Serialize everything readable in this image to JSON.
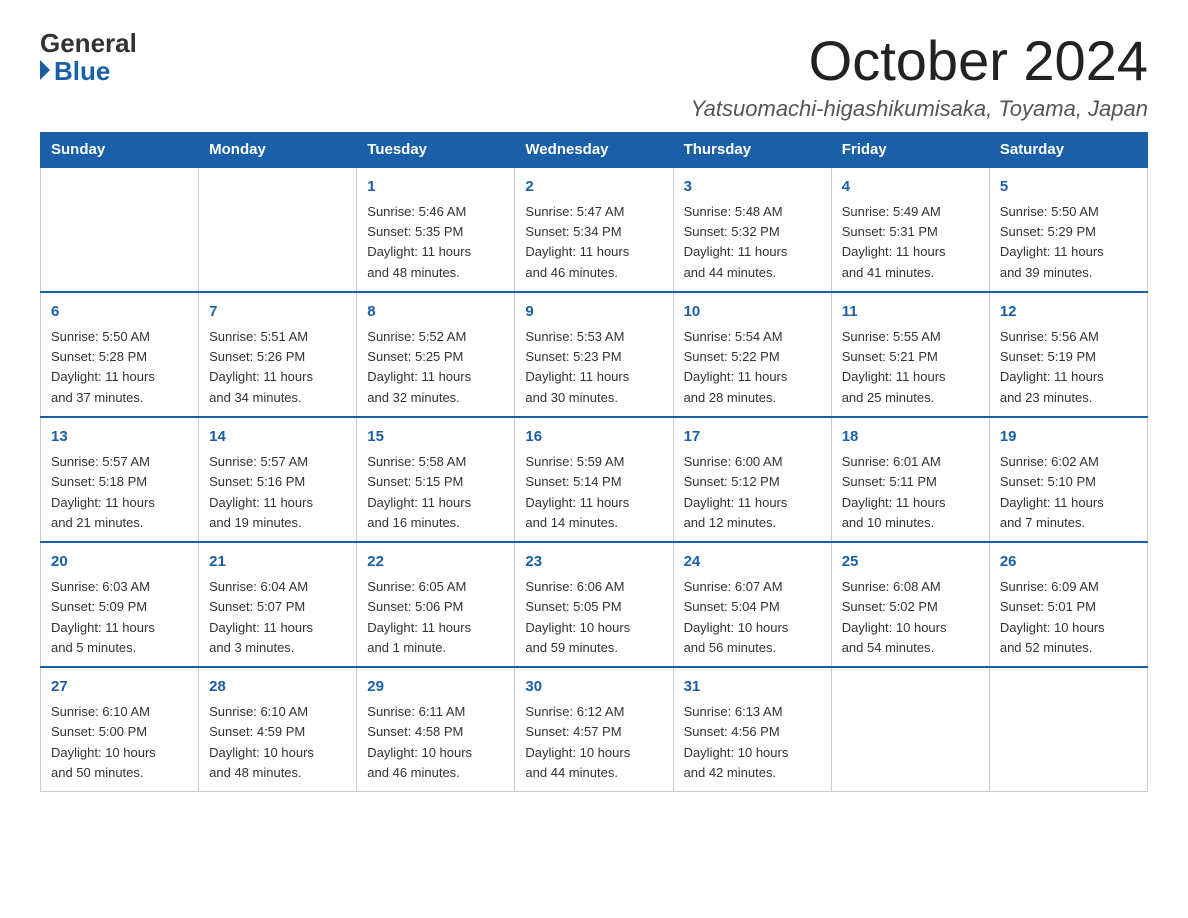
{
  "header": {
    "logo_general": "General",
    "logo_blue": "Blue",
    "month_title": "October 2024",
    "location": "Yatsuomachi-higashikumisaka, Toyama, Japan"
  },
  "weekdays": [
    "Sunday",
    "Monday",
    "Tuesday",
    "Wednesday",
    "Thursday",
    "Friday",
    "Saturday"
  ],
  "weeks": [
    [
      {
        "day": "",
        "info": ""
      },
      {
        "day": "",
        "info": ""
      },
      {
        "day": "1",
        "info": "Sunrise: 5:46 AM\nSunset: 5:35 PM\nDaylight: 11 hours\nand 48 minutes."
      },
      {
        "day": "2",
        "info": "Sunrise: 5:47 AM\nSunset: 5:34 PM\nDaylight: 11 hours\nand 46 minutes."
      },
      {
        "day": "3",
        "info": "Sunrise: 5:48 AM\nSunset: 5:32 PM\nDaylight: 11 hours\nand 44 minutes."
      },
      {
        "day": "4",
        "info": "Sunrise: 5:49 AM\nSunset: 5:31 PM\nDaylight: 11 hours\nand 41 minutes."
      },
      {
        "day": "5",
        "info": "Sunrise: 5:50 AM\nSunset: 5:29 PM\nDaylight: 11 hours\nand 39 minutes."
      }
    ],
    [
      {
        "day": "6",
        "info": "Sunrise: 5:50 AM\nSunset: 5:28 PM\nDaylight: 11 hours\nand 37 minutes."
      },
      {
        "day": "7",
        "info": "Sunrise: 5:51 AM\nSunset: 5:26 PM\nDaylight: 11 hours\nand 34 minutes."
      },
      {
        "day": "8",
        "info": "Sunrise: 5:52 AM\nSunset: 5:25 PM\nDaylight: 11 hours\nand 32 minutes."
      },
      {
        "day": "9",
        "info": "Sunrise: 5:53 AM\nSunset: 5:23 PM\nDaylight: 11 hours\nand 30 minutes."
      },
      {
        "day": "10",
        "info": "Sunrise: 5:54 AM\nSunset: 5:22 PM\nDaylight: 11 hours\nand 28 minutes."
      },
      {
        "day": "11",
        "info": "Sunrise: 5:55 AM\nSunset: 5:21 PM\nDaylight: 11 hours\nand 25 minutes."
      },
      {
        "day": "12",
        "info": "Sunrise: 5:56 AM\nSunset: 5:19 PM\nDaylight: 11 hours\nand 23 minutes."
      }
    ],
    [
      {
        "day": "13",
        "info": "Sunrise: 5:57 AM\nSunset: 5:18 PM\nDaylight: 11 hours\nand 21 minutes."
      },
      {
        "day": "14",
        "info": "Sunrise: 5:57 AM\nSunset: 5:16 PM\nDaylight: 11 hours\nand 19 minutes."
      },
      {
        "day": "15",
        "info": "Sunrise: 5:58 AM\nSunset: 5:15 PM\nDaylight: 11 hours\nand 16 minutes."
      },
      {
        "day": "16",
        "info": "Sunrise: 5:59 AM\nSunset: 5:14 PM\nDaylight: 11 hours\nand 14 minutes."
      },
      {
        "day": "17",
        "info": "Sunrise: 6:00 AM\nSunset: 5:12 PM\nDaylight: 11 hours\nand 12 minutes."
      },
      {
        "day": "18",
        "info": "Sunrise: 6:01 AM\nSunset: 5:11 PM\nDaylight: 11 hours\nand 10 minutes."
      },
      {
        "day": "19",
        "info": "Sunrise: 6:02 AM\nSunset: 5:10 PM\nDaylight: 11 hours\nand 7 minutes."
      }
    ],
    [
      {
        "day": "20",
        "info": "Sunrise: 6:03 AM\nSunset: 5:09 PM\nDaylight: 11 hours\nand 5 minutes."
      },
      {
        "day": "21",
        "info": "Sunrise: 6:04 AM\nSunset: 5:07 PM\nDaylight: 11 hours\nand 3 minutes."
      },
      {
        "day": "22",
        "info": "Sunrise: 6:05 AM\nSunset: 5:06 PM\nDaylight: 11 hours\nand 1 minute."
      },
      {
        "day": "23",
        "info": "Sunrise: 6:06 AM\nSunset: 5:05 PM\nDaylight: 10 hours\nand 59 minutes."
      },
      {
        "day": "24",
        "info": "Sunrise: 6:07 AM\nSunset: 5:04 PM\nDaylight: 10 hours\nand 56 minutes."
      },
      {
        "day": "25",
        "info": "Sunrise: 6:08 AM\nSunset: 5:02 PM\nDaylight: 10 hours\nand 54 minutes."
      },
      {
        "day": "26",
        "info": "Sunrise: 6:09 AM\nSunset: 5:01 PM\nDaylight: 10 hours\nand 52 minutes."
      }
    ],
    [
      {
        "day": "27",
        "info": "Sunrise: 6:10 AM\nSunset: 5:00 PM\nDaylight: 10 hours\nand 50 minutes."
      },
      {
        "day": "28",
        "info": "Sunrise: 6:10 AM\nSunset: 4:59 PM\nDaylight: 10 hours\nand 48 minutes."
      },
      {
        "day": "29",
        "info": "Sunrise: 6:11 AM\nSunset: 4:58 PM\nDaylight: 10 hours\nand 46 minutes."
      },
      {
        "day": "30",
        "info": "Sunrise: 6:12 AM\nSunset: 4:57 PM\nDaylight: 10 hours\nand 44 minutes."
      },
      {
        "day": "31",
        "info": "Sunrise: 6:13 AM\nSunset: 4:56 PM\nDaylight: 10 hours\nand 42 minutes."
      },
      {
        "day": "",
        "info": ""
      },
      {
        "day": "",
        "info": ""
      }
    ]
  ]
}
